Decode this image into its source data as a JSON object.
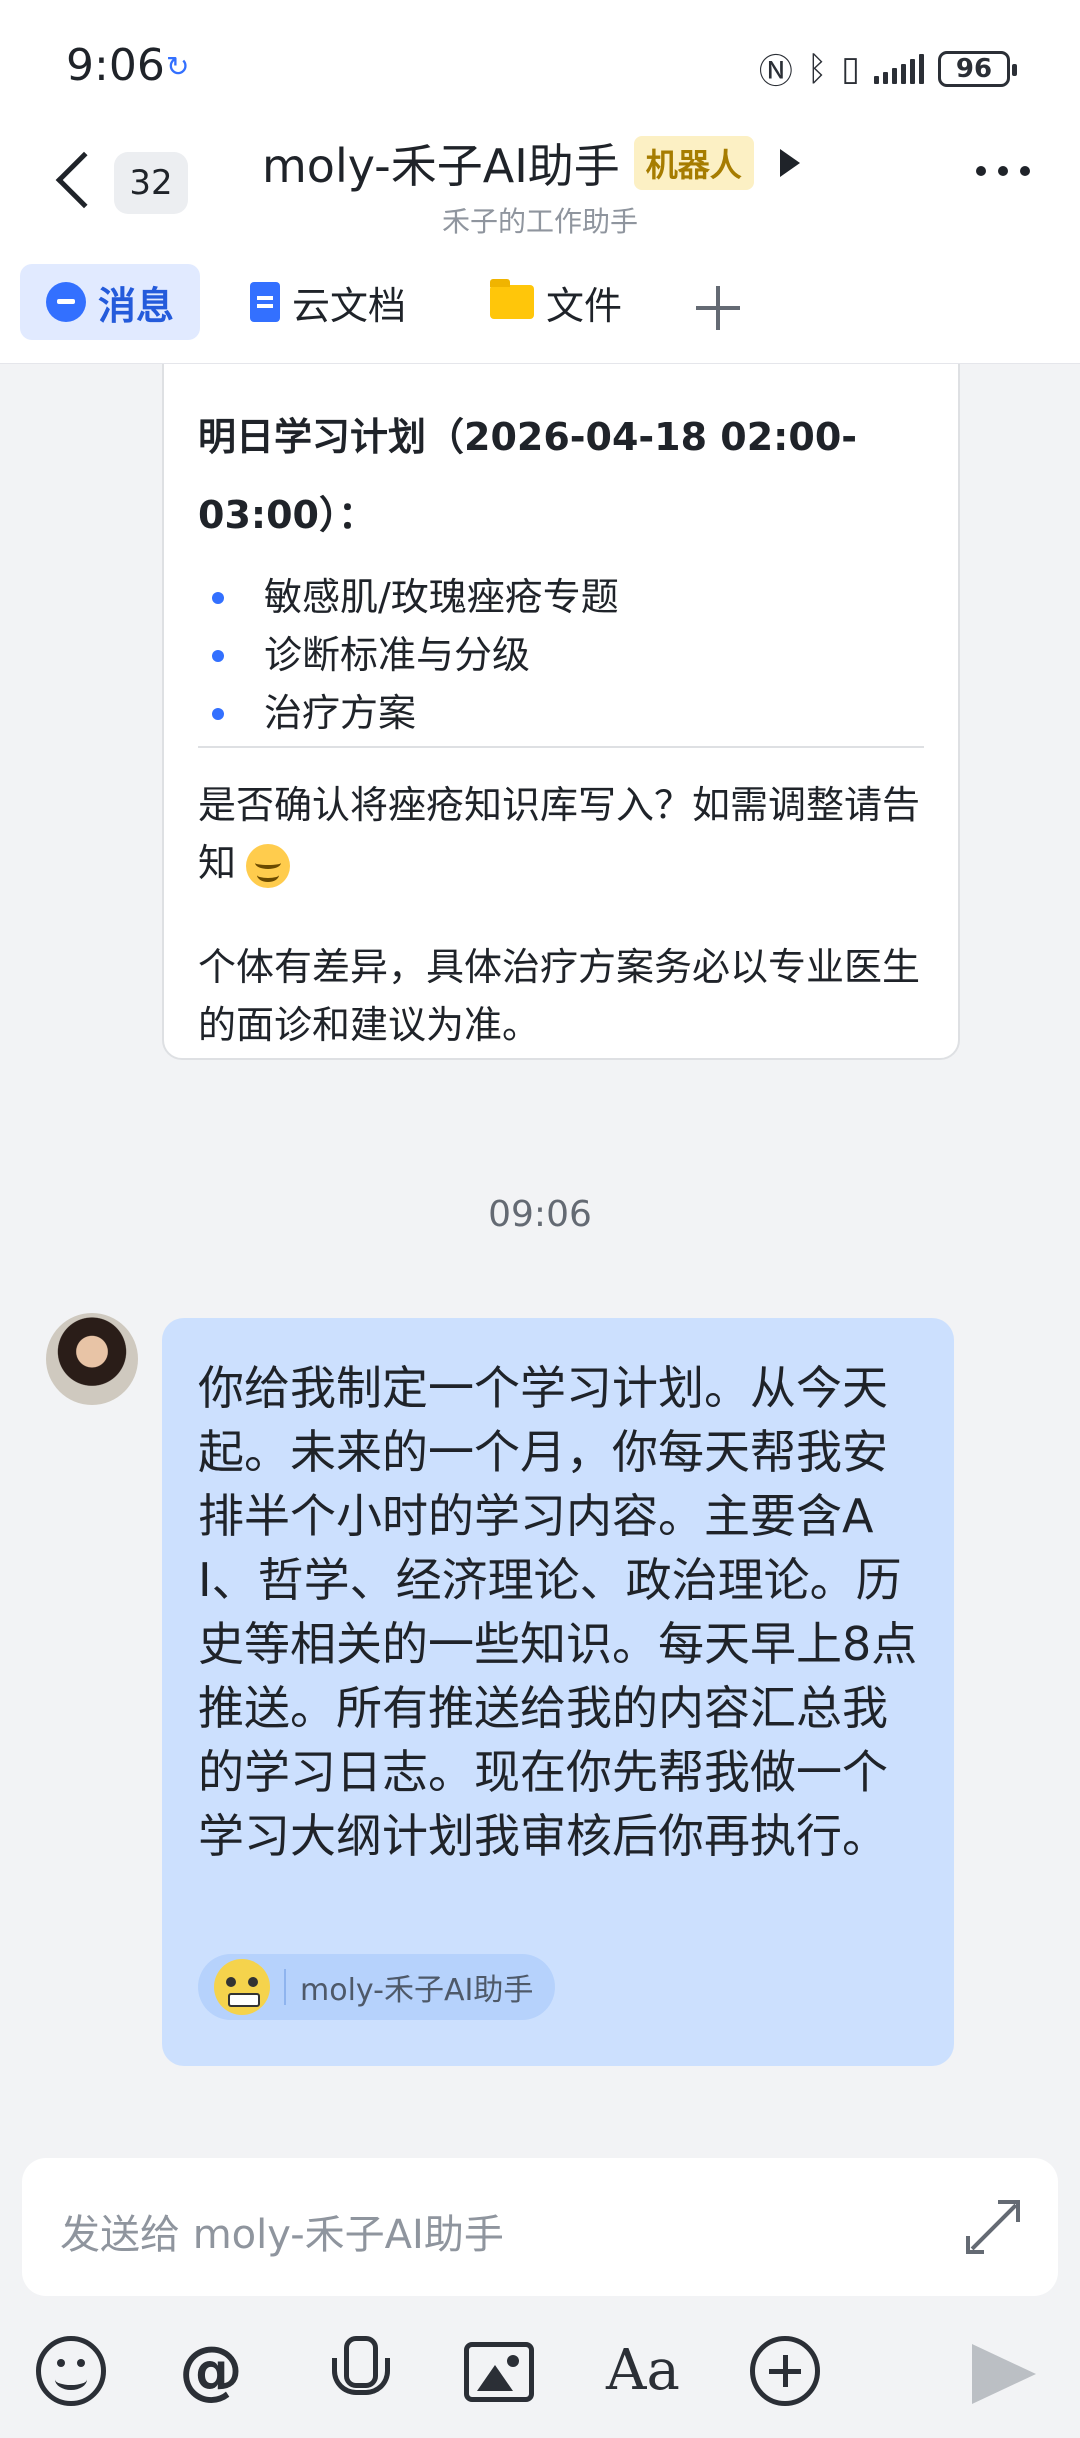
{
  "status_bar": {
    "time": "9:06",
    "icons": [
      "nfc-icon",
      "bluetooth-icon",
      "vibrate-icon",
      "signal-icon"
    ],
    "battery": "96"
  },
  "header": {
    "back_count": "32",
    "title": "moly-禾子AI助手",
    "bot_tag": "机器人",
    "subtitle": "禾子的工作助手"
  },
  "tabs": [
    {
      "label": "消息",
      "icon": "message-icon",
      "active": true
    },
    {
      "label": "云文档",
      "icon": "doc-icon",
      "active": false
    },
    {
      "label": "文件",
      "icon": "folder-icon",
      "active": false
    }
  ],
  "bot_message": {
    "plan_title": "明日学习计划（2026-04-18 02:00-03:00）：",
    "bullets": [
      "敏感肌/玫瑰痤疮专题",
      "诊断标准与分级",
      "治疗方案"
    ],
    "confirm_text": "是否确认将痤疮知识库写入？如需调整请告知",
    "disclaimer": "个体有差异，具体治疗方案务必以专业医生的面诊和建议为准。"
  },
  "timestamp": "09:06",
  "user_message": {
    "text": "你给我制定一个学习计划。从今天起。未来的一个月，你每天帮我安排半个小时的学习内容。主要含AI、哲学、经济理论、政治理论。历史等相关的一些知识。每天早上8点推送。所有推送给我的内容汇总我的学习日志。现在你先帮我做一个学习大纲计划我审核后你再执行。",
    "mention": "moly-禾子AI助手"
  },
  "composer": {
    "placeholder": "发送给 moly-禾子AI助手",
    "font_button": "Aa"
  },
  "colors": {
    "accent": "#3370ff",
    "user_bubble": "#cce0fe",
    "bot_tag_bg": "#fcf0c4",
    "bot_tag_text": "#a67c00"
  }
}
